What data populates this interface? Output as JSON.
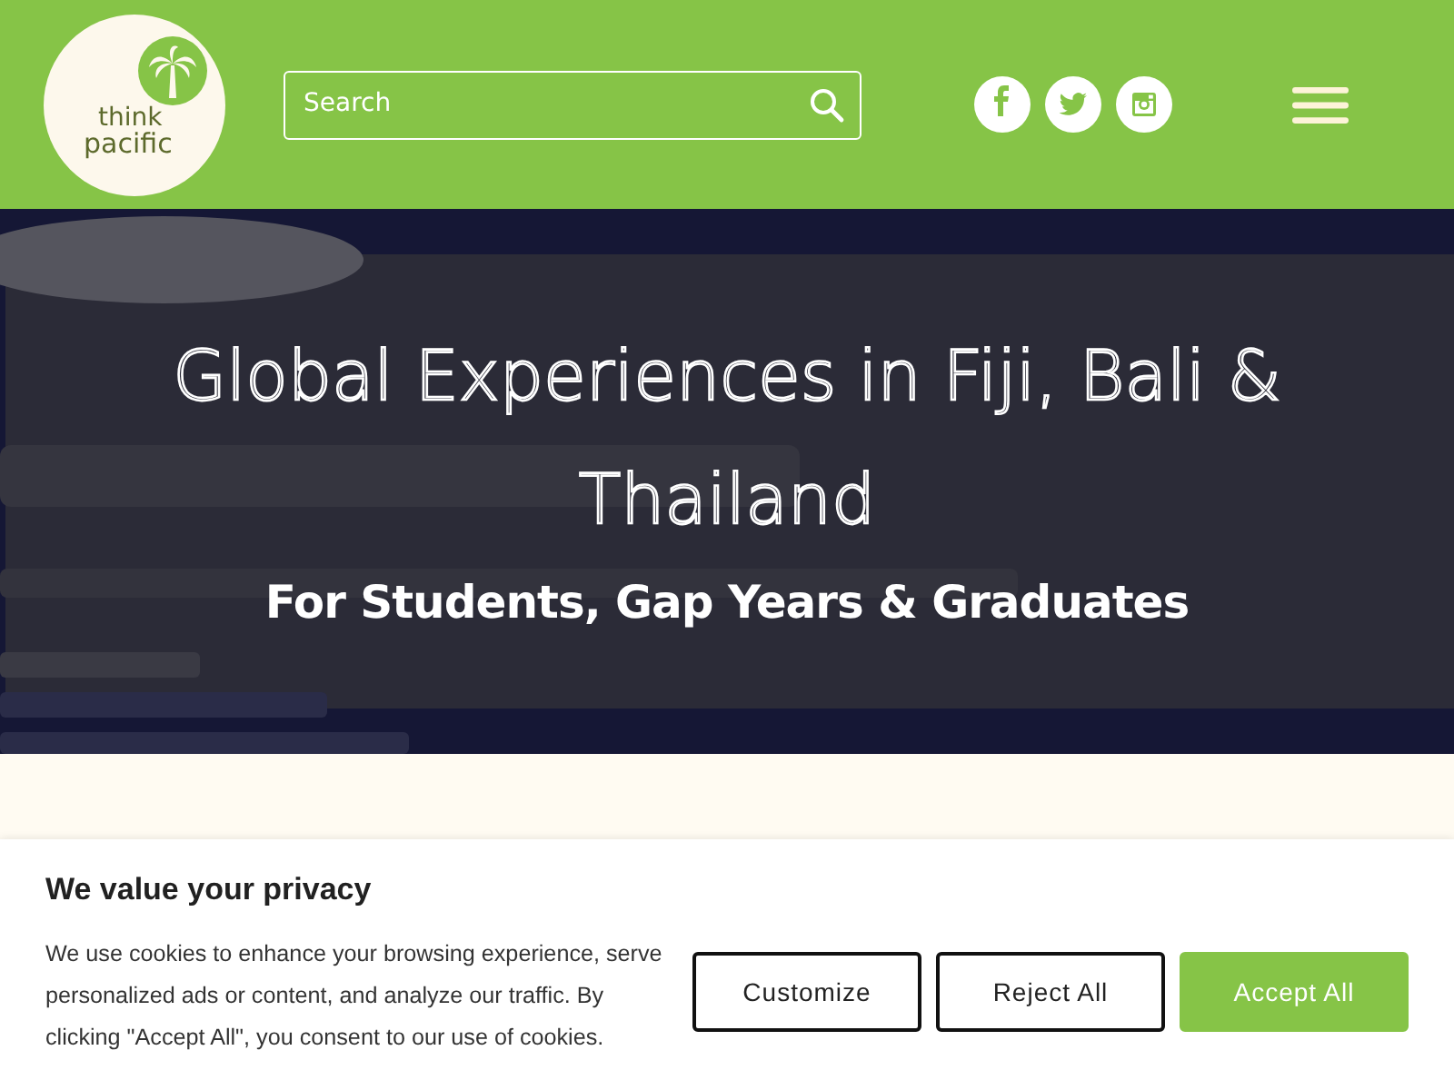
{
  "header": {
    "logo": {
      "line_1": "think",
      "line_2": "pacific"
    },
    "search": {
      "placeholder": "Search"
    },
    "social": [
      {
        "kind": "facebook"
      },
      {
        "kind": "twitter"
      },
      {
        "kind": "instagram"
      }
    ]
  },
  "hero": {
    "title": "Global Experiences in Fiji, Bali & Thailand",
    "subtitle": "For Students, Gap Years & Graduates"
  },
  "cookie_banner": {
    "title": "We value your privacy",
    "text": "We use cookies to enhance your browsing experience, serve personalized ads or content, and analyze our traffic. By clicking \"Accept All\", you consent to our use of cookies.",
    "buttons": [
      {
        "label": "Customize",
        "kind": "outline"
      },
      {
        "label": "Reject All",
        "kind": "outline"
      },
      {
        "label": "Accept All",
        "kind": "primary"
      }
    ]
  }
}
